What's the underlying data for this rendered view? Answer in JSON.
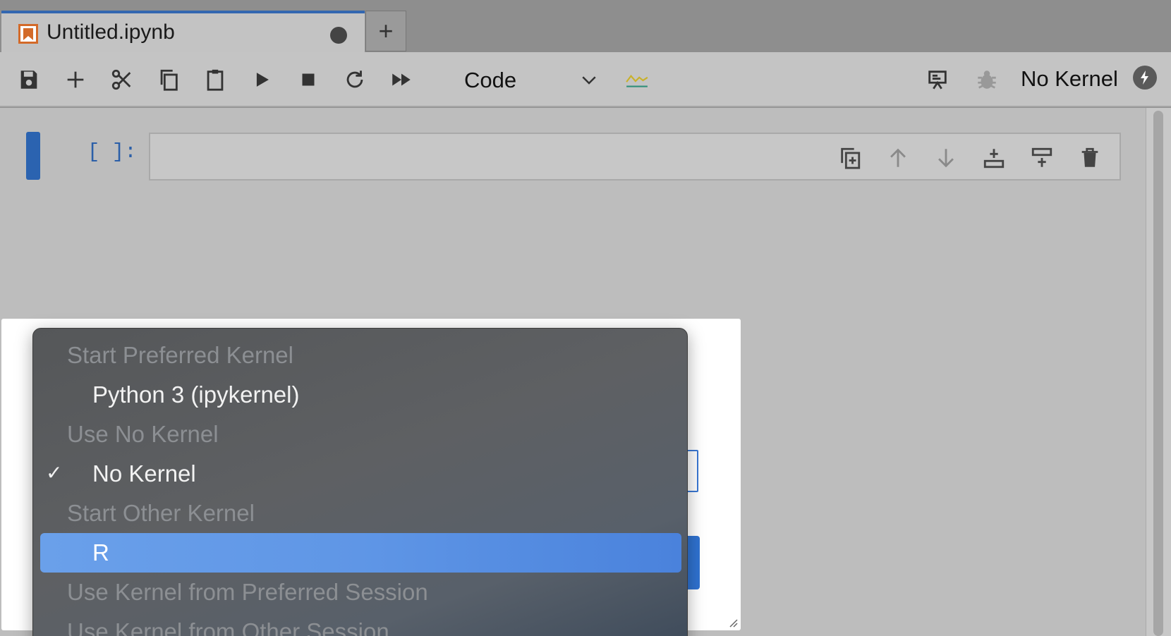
{
  "tab": {
    "title": "Untitled.ipynb",
    "add_label": "+"
  },
  "toolbar": {
    "cell_type": "Code",
    "kernel_name": "No Kernel"
  },
  "cell": {
    "prompt": "[ ]:"
  },
  "kernel_menu": {
    "sections": [
      {
        "header": "Start Preferred Kernel",
        "items": [
          {
            "label": "Python 3 (ipykernel)",
            "checked": false,
            "selected": false
          }
        ]
      },
      {
        "header": "Use No Kernel",
        "items": [
          {
            "label": "No Kernel",
            "checked": true,
            "selected": false
          }
        ]
      },
      {
        "header": "Start Other Kernel",
        "items": [
          {
            "label": "R",
            "checked": false,
            "selected": true
          }
        ]
      },
      {
        "header": "Use Kernel from Preferred Session",
        "items": []
      },
      {
        "header": "Use Kernel from Other Session",
        "items": []
      }
    ],
    "check_glyph": "✓"
  },
  "colors": {
    "accent": "#2b63b0",
    "selection": "#5f96e6",
    "notebook_icon": "#d36a29"
  }
}
